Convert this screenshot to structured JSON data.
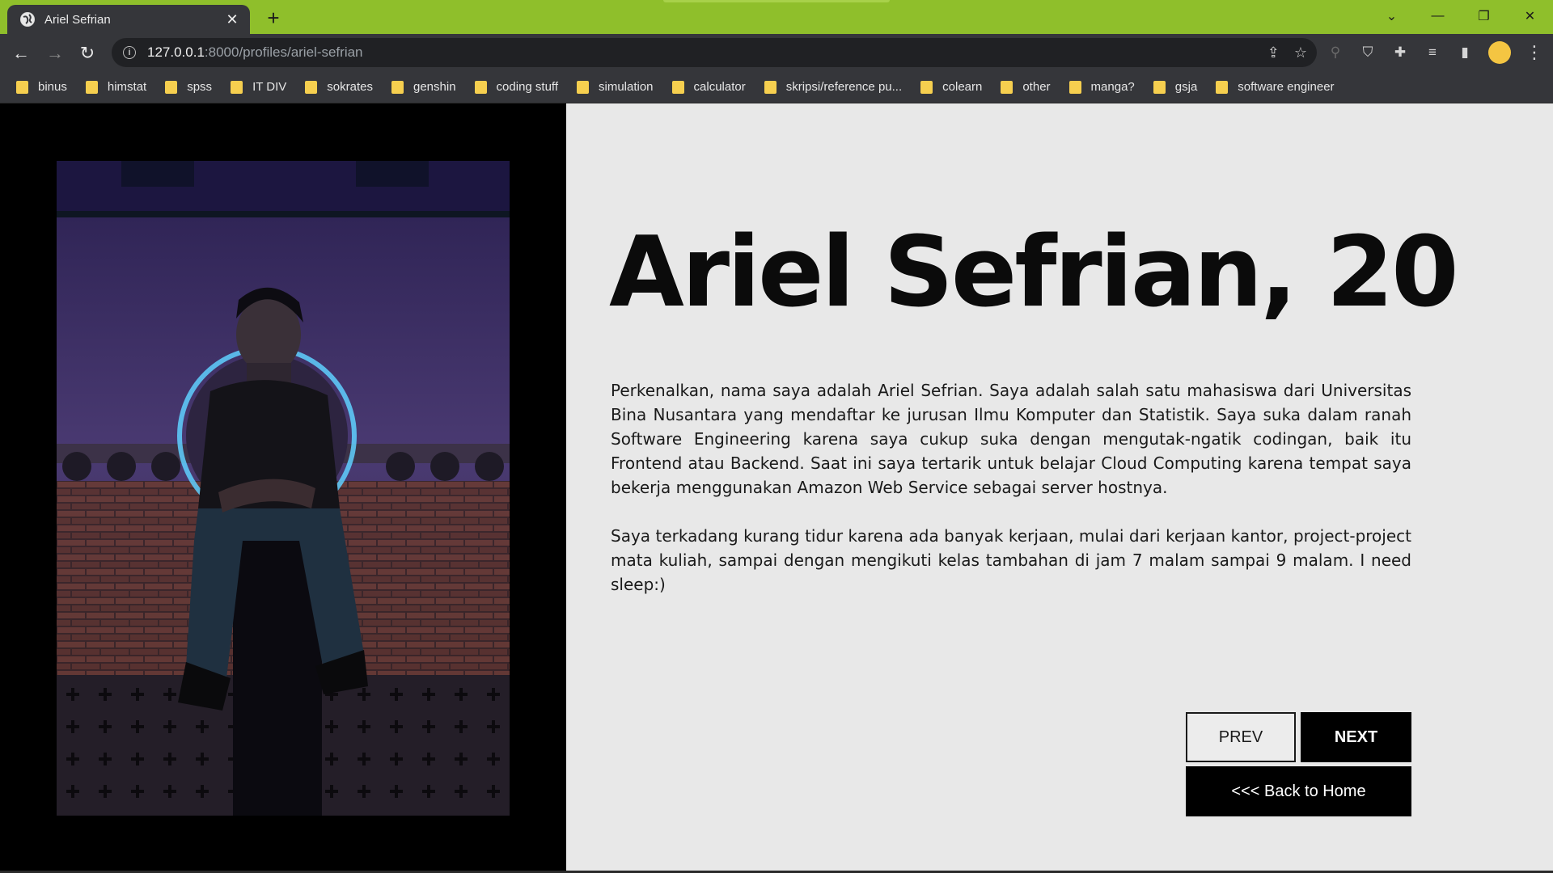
{
  "browser": {
    "tab_title": "Ariel Sefrian",
    "tab_close": "✕",
    "new_tab": "+",
    "url_host": "127.0.0.1",
    "url_path": ":8000/profiles/ariel-sefrian",
    "accent_color": "#8fbf2b",
    "bookmarks": [
      "binus",
      "himstat",
      "spss",
      "IT DIV",
      "sokrates",
      "genshin",
      "coding stuff",
      "simulation",
      "calculator",
      "skripsi/reference pu...",
      "colearn",
      "other",
      "manga?",
      "gsja",
      "software engineer"
    ]
  },
  "profile": {
    "name_age": "Ariel Sefrian, 20",
    "bio_paragraph_1": "Perkenalkan, nama saya adalah Ariel Sefrian. Saya adalah salah satu mahasiswa dari Universitas Bina Nusantara yang mendaftar ke jurusan Ilmu Komputer dan Statistik. Saya suka dalam ranah Software Engineering karena saya cukup suka dengan mengutak-ngatik codingan, baik itu Frontend atau Backend. Saat ini saya tertarik untuk belajar Cloud Computing karena tempat saya bekerja menggunakan Amazon Web Service sebagai server hostnya.",
    "bio_paragraph_2": "Saya terkadang kurang tidur karena ada banyak kerjaan, mulai dari kerjaan kantor, project-project mata kuliah, sampai dengan mengikuti kelas tambahan di jam 7 malam sampai 9 malam. I need sleep:)"
  },
  "nav": {
    "prev_label": "PREV",
    "next_label": "NEXT",
    "home_label": "<<< Back to Home"
  }
}
